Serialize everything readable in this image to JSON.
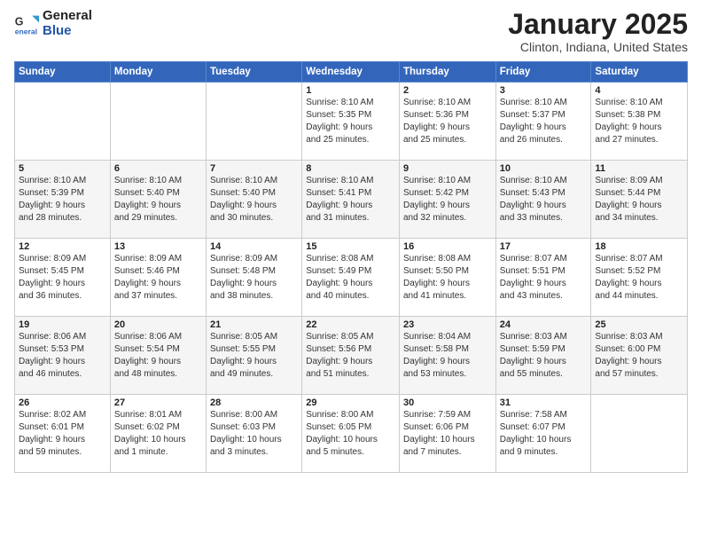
{
  "header": {
    "logo_general": "General",
    "logo_blue": "Blue",
    "title": "January 2025",
    "subtitle": "Clinton, Indiana, United States"
  },
  "weekdays": [
    "Sunday",
    "Monday",
    "Tuesday",
    "Wednesday",
    "Thursday",
    "Friday",
    "Saturday"
  ],
  "weeks": [
    [
      {
        "day": "",
        "info": ""
      },
      {
        "day": "",
        "info": ""
      },
      {
        "day": "",
        "info": ""
      },
      {
        "day": "1",
        "info": "Sunrise: 8:10 AM\nSunset: 5:35 PM\nDaylight: 9 hours\nand 25 minutes."
      },
      {
        "day": "2",
        "info": "Sunrise: 8:10 AM\nSunset: 5:36 PM\nDaylight: 9 hours\nand 25 minutes."
      },
      {
        "day": "3",
        "info": "Sunrise: 8:10 AM\nSunset: 5:37 PM\nDaylight: 9 hours\nand 26 minutes."
      },
      {
        "day": "4",
        "info": "Sunrise: 8:10 AM\nSunset: 5:38 PM\nDaylight: 9 hours\nand 27 minutes."
      }
    ],
    [
      {
        "day": "5",
        "info": "Sunrise: 8:10 AM\nSunset: 5:39 PM\nDaylight: 9 hours\nand 28 minutes."
      },
      {
        "day": "6",
        "info": "Sunrise: 8:10 AM\nSunset: 5:40 PM\nDaylight: 9 hours\nand 29 minutes."
      },
      {
        "day": "7",
        "info": "Sunrise: 8:10 AM\nSunset: 5:40 PM\nDaylight: 9 hours\nand 30 minutes."
      },
      {
        "day": "8",
        "info": "Sunrise: 8:10 AM\nSunset: 5:41 PM\nDaylight: 9 hours\nand 31 minutes."
      },
      {
        "day": "9",
        "info": "Sunrise: 8:10 AM\nSunset: 5:42 PM\nDaylight: 9 hours\nand 32 minutes."
      },
      {
        "day": "10",
        "info": "Sunrise: 8:10 AM\nSunset: 5:43 PM\nDaylight: 9 hours\nand 33 minutes."
      },
      {
        "day": "11",
        "info": "Sunrise: 8:09 AM\nSunset: 5:44 PM\nDaylight: 9 hours\nand 34 minutes."
      }
    ],
    [
      {
        "day": "12",
        "info": "Sunrise: 8:09 AM\nSunset: 5:45 PM\nDaylight: 9 hours\nand 36 minutes."
      },
      {
        "day": "13",
        "info": "Sunrise: 8:09 AM\nSunset: 5:46 PM\nDaylight: 9 hours\nand 37 minutes."
      },
      {
        "day": "14",
        "info": "Sunrise: 8:09 AM\nSunset: 5:48 PM\nDaylight: 9 hours\nand 38 minutes."
      },
      {
        "day": "15",
        "info": "Sunrise: 8:08 AM\nSunset: 5:49 PM\nDaylight: 9 hours\nand 40 minutes."
      },
      {
        "day": "16",
        "info": "Sunrise: 8:08 AM\nSunset: 5:50 PM\nDaylight: 9 hours\nand 41 minutes."
      },
      {
        "day": "17",
        "info": "Sunrise: 8:07 AM\nSunset: 5:51 PM\nDaylight: 9 hours\nand 43 minutes."
      },
      {
        "day": "18",
        "info": "Sunrise: 8:07 AM\nSunset: 5:52 PM\nDaylight: 9 hours\nand 44 minutes."
      }
    ],
    [
      {
        "day": "19",
        "info": "Sunrise: 8:06 AM\nSunset: 5:53 PM\nDaylight: 9 hours\nand 46 minutes."
      },
      {
        "day": "20",
        "info": "Sunrise: 8:06 AM\nSunset: 5:54 PM\nDaylight: 9 hours\nand 48 minutes."
      },
      {
        "day": "21",
        "info": "Sunrise: 8:05 AM\nSunset: 5:55 PM\nDaylight: 9 hours\nand 49 minutes."
      },
      {
        "day": "22",
        "info": "Sunrise: 8:05 AM\nSunset: 5:56 PM\nDaylight: 9 hours\nand 51 minutes."
      },
      {
        "day": "23",
        "info": "Sunrise: 8:04 AM\nSunset: 5:58 PM\nDaylight: 9 hours\nand 53 minutes."
      },
      {
        "day": "24",
        "info": "Sunrise: 8:03 AM\nSunset: 5:59 PM\nDaylight: 9 hours\nand 55 minutes."
      },
      {
        "day": "25",
        "info": "Sunrise: 8:03 AM\nSunset: 6:00 PM\nDaylight: 9 hours\nand 57 minutes."
      }
    ],
    [
      {
        "day": "26",
        "info": "Sunrise: 8:02 AM\nSunset: 6:01 PM\nDaylight: 9 hours\nand 59 minutes."
      },
      {
        "day": "27",
        "info": "Sunrise: 8:01 AM\nSunset: 6:02 PM\nDaylight: 10 hours\nand 1 minute."
      },
      {
        "day": "28",
        "info": "Sunrise: 8:00 AM\nSunset: 6:03 PM\nDaylight: 10 hours\nand 3 minutes."
      },
      {
        "day": "29",
        "info": "Sunrise: 8:00 AM\nSunset: 6:05 PM\nDaylight: 10 hours\nand 5 minutes."
      },
      {
        "day": "30",
        "info": "Sunrise: 7:59 AM\nSunset: 6:06 PM\nDaylight: 10 hours\nand 7 minutes."
      },
      {
        "day": "31",
        "info": "Sunrise: 7:58 AM\nSunset: 6:07 PM\nDaylight: 10 hours\nand 9 minutes."
      },
      {
        "day": "",
        "info": ""
      }
    ]
  ]
}
